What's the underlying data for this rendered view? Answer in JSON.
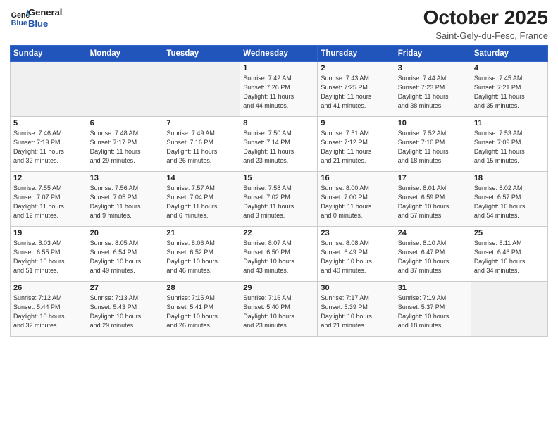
{
  "logo": {
    "line1": "General",
    "line2": "Blue"
  },
  "header": {
    "month_title": "October 2025",
    "subtitle": "Saint-Gely-du-Fesc, France"
  },
  "weekdays": [
    "Sunday",
    "Monday",
    "Tuesday",
    "Wednesday",
    "Thursday",
    "Friday",
    "Saturday"
  ],
  "weeks": [
    [
      {
        "day": "",
        "info": ""
      },
      {
        "day": "",
        "info": ""
      },
      {
        "day": "",
        "info": ""
      },
      {
        "day": "1",
        "info": "Sunrise: 7:42 AM\nSunset: 7:26 PM\nDaylight: 11 hours\nand 44 minutes."
      },
      {
        "day": "2",
        "info": "Sunrise: 7:43 AM\nSunset: 7:25 PM\nDaylight: 11 hours\nand 41 minutes."
      },
      {
        "day": "3",
        "info": "Sunrise: 7:44 AM\nSunset: 7:23 PM\nDaylight: 11 hours\nand 38 minutes."
      },
      {
        "day": "4",
        "info": "Sunrise: 7:45 AM\nSunset: 7:21 PM\nDaylight: 11 hours\nand 35 minutes."
      }
    ],
    [
      {
        "day": "5",
        "info": "Sunrise: 7:46 AM\nSunset: 7:19 PM\nDaylight: 11 hours\nand 32 minutes."
      },
      {
        "day": "6",
        "info": "Sunrise: 7:48 AM\nSunset: 7:17 PM\nDaylight: 11 hours\nand 29 minutes."
      },
      {
        "day": "7",
        "info": "Sunrise: 7:49 AM\nSunset: 7:16 PM\nDaylight: 11 hours\nand 26 minutes."
      },
      {
        "day": "8",
        "info": "Sunrise: 7:50 AM\nSunset: 7:14 PM\nDaylight: 11 hours\nand 23 minutes."
      },
      {
        "day": "9",
        "info": "Sunrise: 7:51 AM\nSunset: 7:12 PM\nDaylight: 11 hours\nand 21 minutes."
      },
      {
        "day": "10",
        "info": "Sunrise: 7:52 AM\nSunset: 7:10 PM\nDaylight: 11 hours\nand 18 minutes."
      },
      {
        "day": "11",
        "info": "Sunrise: 7:53 AM\nSunset: 7:09 PM\nDaylight: 11 hours\nand 15 minutes."
      }
    ],
    [
      {
        "day": "12",
        "info": "Sunrise: 7:55 AM\nSunset: 7:07 PM\nDaylight: 11 hours\nand 12 minutes."
      },
      {
        "day": "13",
        "info": "Sunrise: 7:56 AM\nSunset: 7:05 PM\nDaylight: 11 hours\nand 9 minutes."
      },
      {
        "day": "14",
        "info": "Sunrise: 7:57 AM\nSunset: 7:04 PM\nDaylight: 11 hours\nand 6 minutes."
      },
      {
        "day": "15",
        "info": "Sunrise: 7:58 AM\nSunset: 7:02 PM\nDaylight: 11 hours\nand 3 minutes."
      },
      {
        "day": "16",
        "info": "Sunrise: 8:00 AM\nSunset: 7:00 PM\nDaylight: 11 hours\nand 0 minutes."
      },
      {
        "day": "17",
        "info": "Sunrise: 8:01 AM\nSunset: 6:59 PM\nDaylight: 10 hours\nand 57 minutes."
      },
      {
        "day": "18",
        "info": "Sunrise: 8:02 AM\nSunset: 6:57 PM\nDaylight: 10 hours\nand 54 minutes."
      }
    ],
    [
      {
        "day": "19",
        "info": "Sunrise: 8:03 AM\nSunset: 6:55 PM\nDaylight: 10 hours\nand 51 minutes."
      },
      {
        "day": "20",
        "info": "Sunrise: 8:05 AM\nSunset: 6:54 PM\nDaylight: 10 hours\nand 49 minutes."
      },
      {
        "day": "21",
        "info": "Sunrise: 8:06 AM\nSunset: 6:52 PM\nDaylight: 10 hours\nand 46 minutes."
      },
      {
        "day": "22",
        "info": "Sunrise: 8:07 AM\nSunset: 6:50 PM\nDaylight: 10 hours\nand 43 minutes."
      },
      {
        "day": "23",
        "info": "Sunrise: 8:08 AM\nSunset: 6:49 PM\nDaylight: 10 hours\nand 40 minutes."
      },
      {
        "day": "24",
        "info": "Sunrise: 8:10 AM\nSunset: 6:47 PM\nDaylight: 10 hours\nand 37 minutes."
      },
      {
        "day": "25",
        "info": "Sunrise: 8:11 AM\nSunset: 6:46 PM\nDaylight: 10 hours\nand 34 minutes."
      }
    ],
    [
      {
        "day": "26",
        "info": "Sunrise: 7:12 AM\nSunset: 5:44 PM\nDaylight: 10 hours\nand 32 minutes."
      },
      {
        "day": "27",
        "info": "Sunrise: 7:13 AM\nSunset: 5:43 PM\nDaylight: 10 hours\nand 29 minutes."
      },
      {
        "day": "28",
        "info": "Sunrise: 7:15 AM\nSunset: 5:41 PM\nDaylight: 10 hours\nand 26 minutes."
      },
      {
        "day": "29",
        "info": "Sunrise: 7:16 AM\nSunset: 5:40 PM\nDaylight: 10 hours\nand 23 minutes."
      },
      {
        "day": "30",
        "info": "Sunrise: 7:17 AM\nSunset: 5:39 PM\nDaylight: 10 hours\nand 21 minutes."
      },
      {
        "day": "31",
        "info": "Sunrise: 7:19 AM\nSunset: 5:37 PM\nDaylight: 10 hours\nand 18 minutes."
      },
      {
        "day": "",
        "info": ""
      }
    ]
  ]
}
